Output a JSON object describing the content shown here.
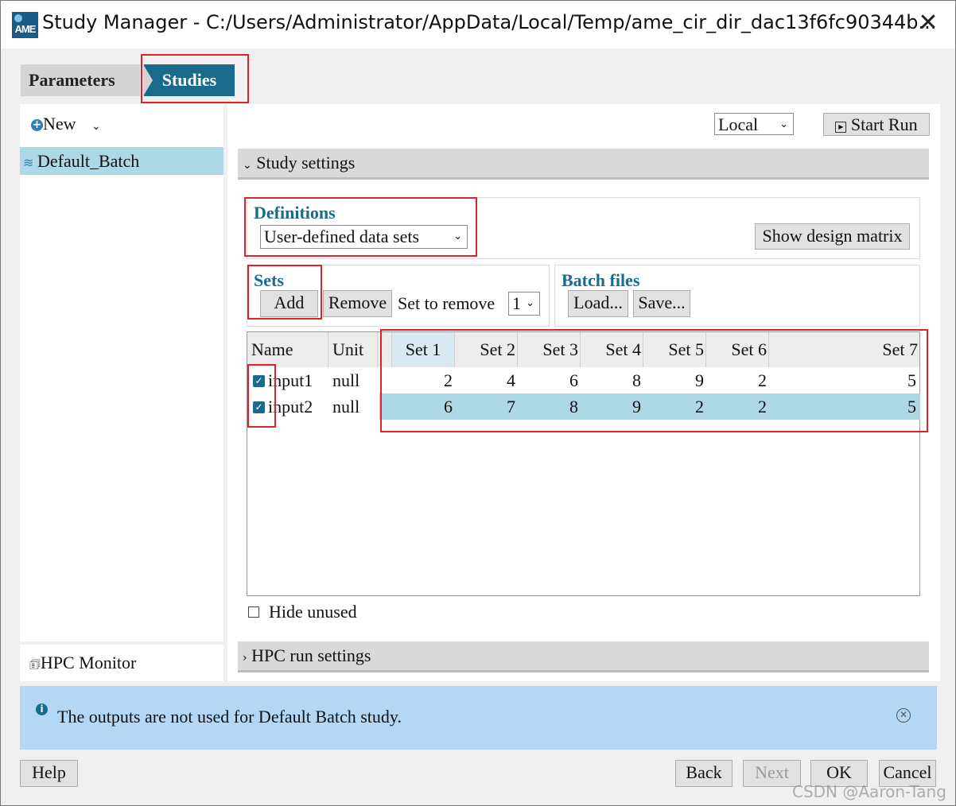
{
  "window": {
    "title": "Study Manager - C:/Users/Administrator/AppData/Local/Temp/ame_cir_dir_dac13f6fc90344b...",
    "logo_text": "AME"
  },
  "tabs": [
    {
      "label": "Parameters",
      "active": false
    },
    {
      "label": "Studies",
      "active": true
    }
  ],
  "sidebar": {
    "new_label": "New",
    "items": [
      {
        "label": "Default_Batch",
        "selected": true
      }
    ],
    "hpc_monitor_label": "HPC Monitor"
  },
  "toolbar": {
    "run_location": "Local",
    "start_run_label": "Start Run"
  },
  "study_settings": {
    "header": "Study settings",
    "definitions_label": "Definitions",
    "definitions_value": "User-defined data sets",
    "show_design_matrix_label": "Show design matrix",
    "sets_label": "Sets",
    "add_label": "Add",
    "remove_label": "Remove",
    "set_to_remove_label": "Set to remove",
    "set_to_remove_value": "1",
    "batch_files_label": "Batch files",
    "load_label": "Load...",
    "save_label": "Save...",
    "hide_unused_label": "Hide unused",
    "hide_unused_checked": false
  },
  "table": {
    "columns": [
      "Name",
      "Unit",
      "Set 1",
      "Set 2",
      "Set 3",
      "Set 4",
      "Set 5",
      "Set 6",
      "Set 7"
    ],
    "rows": [
      {
        "checked": true,
        "name": "input1",
        "unit": "null",
        "values": [
          "2",
          "4",
          "6",
          "8",
          "9",
          "2",
          "5"
        ]
      },
      {
        "checked": true,
        "name": "input2",
        "unit": "null",
        "values": [
          "6",
          "7",
          "8",
          "9",
          "2",
          "2",
          "5"
        ]
      }
    ]
  },
  "hpc_settings": {
    "header": "HPC run settings"
  },
  "info_bar": {
    "message": "The outputs are not used for Default Batch study."
  },
  "footer": {
    "help_label": "Help",
    "back_label": "Back",
    "next_label": "Next",
    "ok_label": "OK",
    "cancel_label": "Cancel"
  },
  "watermark": "CSDN @Aaron-Tang",
  "colors": {
    "accent": "#1a6a8c",
    "selection": "#add8e6",
    "info_bg": "#b3d7f5",
    "annotation": "#e0212c"
  }
}
